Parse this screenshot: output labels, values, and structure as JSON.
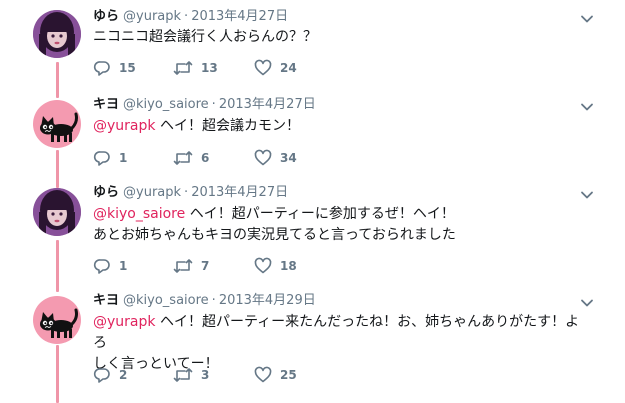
{
  "colors": {
    "mention": "#e0245e",
    "thread_line": "#ef95a8",
    "muted": "#657786"
  },
  "tweets": [
    {
      "name": "ゆら",
      "handle": "@yurapk",
      "separator": "·",
      "date": "2013年4月27日",
      "mention": "",
      "text": "ニコニコ超会議行く人おらんの？？",
      "text2": "",
      "replies": "15",
      "retweets": "13",
      "likes": "24",
      "avatar": "girl-avatar"
    },
    {
      "name": "キヨ",
      "handle": "@kiyo_saiore",
      "separator": "·",
      "date": "2013年4月27日",
      "mention": "@yurapk",
      "text": " ヘイ！超会議カモン！",
      "text2": "",
      "replies": "1",
      "retweets": "6",
      "likes": "34",
      "avatar": "cat-avatar"
    },
    {
      "name": "ゆら",
      "handle": "@yurapk",
      "separator": "·",
      "date": "2013年4月27日",
      "mention": "@kiyo_saiore",
      "text": " ヘイ！超パーティーに参加するぜ！ヘイ！",
      "text2": "あとお姉ちゃんもキヨの実況見てると言っておられました",
      "replies": "1",
      "retweets": "7",
      "likes": "18",
      "avatar": "girl-avatar"
    },
    {
      "name": "キヨ",
      "handle": "@kiyo_saiore",
      "separator": "·",
      "date": "2013年4月29日",
      "mention": "@yurapk",
      "text": " ヘイ！超パーティー来たんだったね！お、姉ちゃんありがたす！よろ",
      "text2": "しく言っといてー！",
      "replies": "2",
      "retweets": "3",
      "likes": "25",
      "avatar": "cat-avatar"
    }
  ]
}
